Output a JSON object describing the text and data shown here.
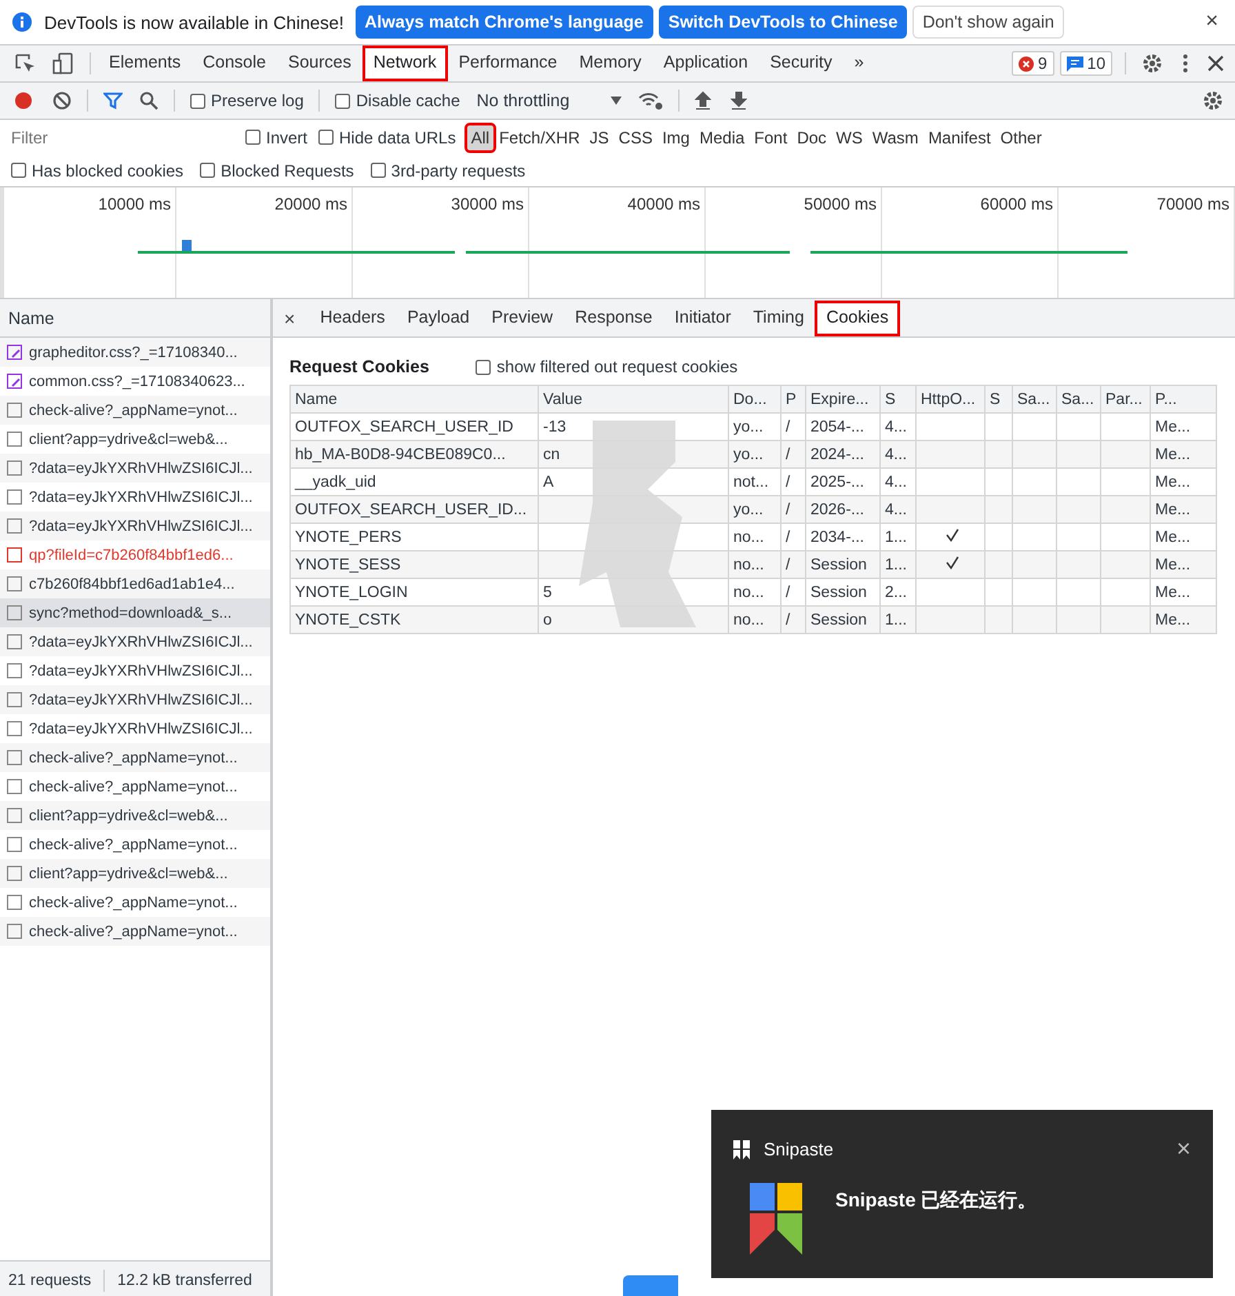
{
  "infobar": {
    "message": "DevTools is now available in Chinese!",
    "buttons": [
      {
        "label": "Always match Chrome's language",
        "kind": "primary"
      },
      {
        "label": "Switch DevTools to Chinese",
        "kind": "primary"
      },
      {
        "label": "Don't show again",
        "kind": "secondary"
      }
    ],
    "close": "×"
  },
  "main_tabs": [
    {
      "label": "Elements",
      "selected": false,
      "highlighted": false
    },
    {
      "label": "Console",
      "selected": false,
      "highlighted": false
    },
    {
      "label": "Sources",
      "selected": false,
      "highlighted": false
    },
    {
      "label": "Network",
      "selected": true,
      "highlighted": true
    },
    {
      "label": "Performance",
      "selected": false,
      "highlighted": false
    },
    {
      "label": "Memory",
      "selected": false,
      "highlighted": false
    },
    {
      "label": "Application",
      "selected": false,
      "highlighted": false
    },
    {
      "label": "Security",
      "selected": false,
      "highlighted": false
    }
  ],
  "more_tabs": "»",
  "error_count": "9",
  "message_count": "10",
  "toolbar": {
    "preserve_log": {
      "label": "Preserve log",
      "checked": false
    },
    "disable_cache": {
      "label": "Disable cache",
      "checked": false
    },
    "throttling": "No throttling"
  },
  "filter": {
    "placeholder": "Filter",
    "invert": {
      "label": "Invert",
      "checked": false
    },
    "hide_data_urls": {
      "label": "Hide data URLs",
      "checked": false
    },
    "types": [
      {
        "label": "All",
        "selected": true,
        "highlighted": true
      },
      {
        "label": "Fetch/XHR",
        "selected": false,
        "highlighted": false
      },
      {
        "label": "JS",
        "selected": false,
        "highlighted": false
      },
      {
        "label": "CSS",
        "selected": false,
        "highlighted": false
      },
      {
        "label": "Img",
        "selected": false,
        "highlighted": false
      },
      {
        "label": "Media",
        "selected": false,
        "highlighted": false
      },
      {
        "label": "Font",
        "selected": false,
        "highlighted": false
      },
      {
        "label": "Doc",
        "selected": false,
        "highlighted": false
      },
      {
        "label": "WS",
        "selected": false,
        "highlighted": false
      },
      {
        "label": "Wasm",
        "selected": false,
        "highlighted": false
      },
      {
        "label": "Manifest",
        "selected": false,
        "highlighted": false
      },
      {
        "label": "Other",
        "selected": false,
        "highlighted": false
      }
    ],
    "options": [
      {
        "label": "Has blocked cookies",
        "checked": false
      },
      {
        "label": "Blocked Requests",
        "checked": false
      },
      {
        "label": "3rd-party requests",
        "checked": false
      }
    ]
  },
  "timeline": {
    "ticks": [
      "10000 ms",
      "20000 ms",
      "30000 ms",
      "40000 ms",
      "50000 ms",
      "60000 ms",
      "70000 ms"
    ]
  },
  "requests_header": "Name",
  "requests": [
    {
      "name": "grapheditor.css?_=17108340...",
      "kind": "css",
      "selected": false
    },
    {
      "name": "common.css?_=17108340623...",
      "kind": "css",
      "selected": false
    },
    {
      "name": "check-alive?_appName=ynot...",
      "kind": "other",
      "selected": false
    },
    {
      "name": "client?app=ydrive&cl=web&...",
      "kind": "other",
      "selected": false
    },
    {
      "name": "?data=eyJkYXRhVHlwZSI6ICJl...",
      "kind": "other",
      "selected": false
    },
    {
      "name": "?data=eyJkYXRhVHlwZSI6ICJl...",
      "kind": "other",
      "selected": false
    },
    {
      "name": "?data=eyJkYXRhVHlwZSI6ICJl...",
      "kind": "other",
      "selected": false
    },
    {
      "name": "qp?fileId=c7b260f84bbf1ed6...",
      "kind": "error",
      "selected": false
    },
    {
      "name": "c7b260f84bbf1ed6ad1ab1e4...",
      "kind": "other",
      "selected": false
    },
    {
      "name": "sync?method=download&_s...",
      "kind": "other",
      "selected": true
    },
    {
      "name": "?data=eyJkYXRhVHlwZSI6ICJl...",
      "kind": "other",
      "selected": false
    },
    {
      "name": "?data=eyJkYXRhVHlwZSI6ICJl...",
      "kind": "other",
      "selected": false
    },
    {
      "name": "?data=eyJkYXRhVHlwZSI6ICJl...",
      "kind": "other",
      "selected": false
    },
    {
      "name": "?data=eyJkYXRhVHlwZSI6ICJl...",
      "kind": "other",
      "selected": false
    },
    {
      "name": "check-alive?_appName=ynot...",
      "kind": "other",
      "selected": false
    },
    {
      "name": "check-alive?_appName=ynot...",
      "kind": "other",
      "selected": false
    },
    {
      "name": "client?app=ydrive&cl=web&...",
      "kind": "other",
      "selected": false
    },
    {
      "name": "check-alive?_appName=ynot...",
      "kind": "other",
      "selected": false
    },
    {
      "name": "client?app=ydrive&cl=web&...",
      "kind": "other",
      "selected": false
    },
    {
      "name": "check-alive?_appName=ynot...",
      "kind": "other",
      "selected": false
    },
    {
      "name": "check-alive?_appName=ynot...",
      "kind": "other",
      "selected": false
    }
  ],
  "status_bar": {
    "requests": "21 requests",
    "transferred": "12.2 kB transferred"
  },
  "detail_tabs": [
    {
      "label": "Headers",
      "selected": false,
      "highlighted": false
    },
    {
      "label": "Payload",
      "selected": false,
      "highlighted": false
    },
    {
      "label": "Preview",
      "selected": false,
      "highlighted": false
    },
    {
      "label": "Response",
      "selected": false,
      "highlighted": false
    },
    {
      "label": "Initiator",
      "selected": false,
      "highlighted": false
    },
    {
      "label": "Timing",
      "selected": false,
      "highlighted": false
    },
    {
      "label": "Cookies",
      "selected": true,
      "highlighted": true
    }
  ],
  "detail_close": "×",
  "cookies": {
    "title": "Request Cookies",
    "show_filtered": {
      "label": "show filtered out request cookies",
      "checked": false
    },
    "columns": [
      "Name",
      "Value",
      "Do...",
      "P",
      "Expire...",
      "S",
      "HttpO...",
      "S",
      "Sa...",
      "Sa...",
      "Par...",
      "P..."
    ],
    "rows": [
      {
        "cells": [
          "OUTFOX_SEARCH_USER_ID",
          "-13",
          "yo...",
          "/",
          "2054-...",
          "4...",
          "",
          "",
          "",
          "",
          "",
          "Me..."
        ],
        "http_only": false
      },
      {
        "cells": [
          "hb_MA-B0D8-94CBE089C0...",
          "cn",
          "yo...",
          "/",
          "2024-...",
          "4...",
          "",
          "",
          "",
          "",
          "",
          "Me..."
        ],
        "http_only": false
      },
      {
        "cells": [
          "__yadk_uid",
          "A",
          "not...",
          "/",
          "2025-...",
          "4...",
          "",
          "",
          "",
          "",
          "",
          "Me..."
        ],
        "http_only": false
      },
      {
        "cells": [
          "OUTFOX_SEARCH_USER_ID...",
          "",
          "yo...",
          "/",
          "2026-...",
          "4...",
          "",
          "",
          "",
          "",
          "",
          "Me..."
        ],
        "http_only": false
      },
      {
        "cells": [
          "YNOTE_PERS",
          "",
          "no...",
          "/",
          "2034-...",
          "1...",
          "",
          "",
          "",
          "",
          "",
          "Me..."
        ],
        "http_only": true
      },
      {
        "cells": [
          "YNOTE_SESS",
          "",
          "no...",
          "/",
          "Session",
          "1...",
          "",
          "",
          "",
          "",
          "",
          "Me..."
        ],
        "http_only": true
      },
      {
        "cells": [
          "YNOTE_LOGIN",
          "5",
          "no...",
          "/",
          "Session",
          "2...",
          "",
          "",
          "",
          "",
          "",
          "Me..."
        ],
        "http_only": false
      },
      {
        "cells": [
          "YNOTE_CSTK",
          "o",
          "no...",
          "/",
          "Session",
          "1...",
          "",
          "",
          "",
          "",
          "",
          "Me..."
        ],
        "http_only": false
      }
    ]
  },
  "toast": {
    "app": "Snipaste",
    "message": "Snipaste 已经在运行。",
    "close": "×"
  }
}
